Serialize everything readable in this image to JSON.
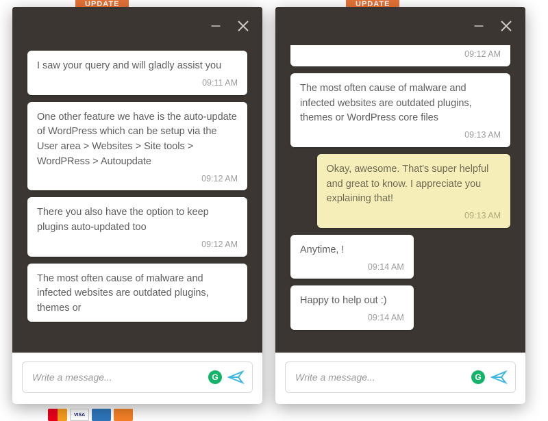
{
  "bg": {
    "update_label": "UPDATE",
    "cards": [
      "MC",
      "VISA",
      "AMEX",
      "DISC"
    ]
  },
  "left": {
    "messages": [
      {
        "text": "I saw your query and will gladly assist you",
        "time": "09:11 AM",
        "who": "agent"
      },
      {
        "text": "One other feature we have is the auto-update of WordPress which can be setup via the User area > Websites > Site tools > WordPRess > Autoupdate",
        "time": "09:12 AM",
        "who": "agent"
      },
      {
        "text": "There you also have the option to keep plugins auto-updated too",
        "time": "09:12 AM",
        "who": "agent"
      },
      {
        "text": "The most often cause of malware and infected websites are outdated plugins, themes or",
        "time": "",
        "who": "agent"
      }
    ],
    "composer_placeholder": "Write a message..."
  },
  "right": {
    "messages": [
      {
        "text": "",
        "time": "09:12 AM",
        "who": "agent",
        "partial_top": true
      },
      {
        "text": "The most often cause of malware and infected websites are outdated plugins, themes or WordPress core files",
        "time": "09:13 AM",
        "who": "agent"
      },
      {
        "text": "Okay, awesome. That's super helpful and great to know. I appreciate you explaining that!",
        "time": "09:13 AM",
        "who": "self"
      },
      {
        "text": "Anytime,          !",
        "time": "09:14 AM",
        "who": "agent",
        "narrow": true
      },
      {
        "text": "Happy to help out :)",
        "time": "09:14 AM",
        "who": "agent",
        "narrow": true
      }
    ],
    "composer_placeholder": "Write a message..."
  },
  "icons": {
    "minimize": "minimize",
    "close": "close",
    "grammarly": "G",
    "send": "send"
  }
}
